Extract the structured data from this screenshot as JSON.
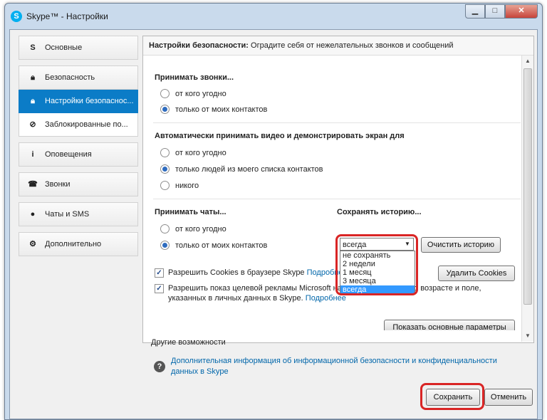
{
  "window": {
    "title": "Skype™ - Настройки",
    "app_icon": "S"
  },
  "sidebar": {
    "items": [
      {
        "label": "Основные",
        "icon": "skype-icon"
      },
      {
        "label": "Безопасность",
        "icon": "lock-icon"
      },
      {
        "label": "Настройки безопаснос...",
        "icon": "lock-icon",
        "active": true
      },
      {
        "label": "Заблокированные по...",
        "icon": "block-icon"
      },
      {
        "label": "Оповещения",
        "icon": "info-icon"
      },
      {
        "label": "Звонки",
        "icon": "phone-icon"
      },
      {
        "label": "Чаты и SMS",
        "icon": "chat-icon"
      },
      {
        "label": "Дополнительно",
        "icon": "gear-icon"
      }
    ]
  },
  "panel": {
    "head_bold": "Настройки безопасности:",
    "head_rest": " Оградите себя от нежелательных звонков и сообщений",
    "calls": {
      "title": "Принимать звонки...",
      "options": [
        "от кого угодно",
        "только от моих контактов"
      ],
      "selected": 1
    },
    "video": {
      "title": "Автоматически принимать видео и демонстрировать экран для",
      "options": [
        "от кого угодно",
        "только людей из моего списка контактов",
        "никого"
      ],
      "selected": 1
    },
    "chats": {
      "title": "Принимать чаты...",
      "options": [
        "от кого угодно",
        "только от моих контактов"
      ],
      "selected": 1
    },
    "history": {
      "title": "Сохранять историю...",
      "value": "всегда",
      "options": [
        "не сохранять",
        "2 недели",
        "1 месяц",
        "3 месяца",
        "всегда"
      ],
      "clear_button": "Очистить историю"
    },
    "cookies": {
      "label": "Разрешить Cookies в браузере Skype",
      "link": "Подробнее",
      "button": "Удалить Cookies",
      "checked": true
    },
    "ads": {
      "label": "Разрешить показ целевой рекламы Microsoft на основании данных о возрасте и поле, указанных в личных данных в Skype.",
      "link": "Подробнее",
      "checked": true
    },
    "show_params_button": "Показать основные параметры"
  },
  "other": {
    "title": "Другие возможности",
    "link": "Дополнительная информация об информационной безопасности и конфиденциальности данных в Skype"
  },
  "footer": {
    "save": "Сохранить",
    "cancel": "Отменить"
  },
  "colors": {
    "accent": "#0b7cc7",
    "highlight": "#d92525",
    "selection": "#3399ff"
  }
}
